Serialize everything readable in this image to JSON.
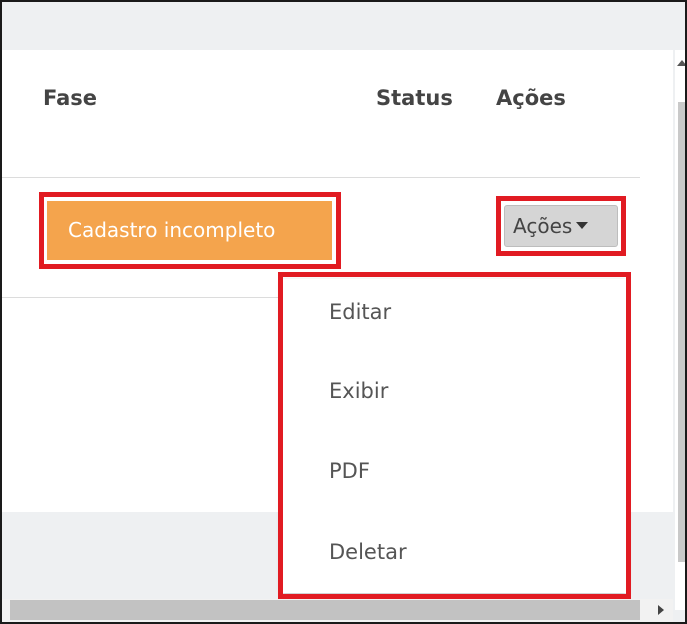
{
  "table": {
    "headers": {
      "fase": "Fase",
      "status": "Status",
      "acoes": "Ações"
    },
    "row": {
      "fase_badge": "Cadastro incompleto",
      "acoes_button": "Ações"
    }
  },
  "dropdown": {
    "items": [
      {
        "label": "Editar"
      },
      {
        "label": "Exibir"
      },
      {
        "label": "PDF"
      },
      {
        "label": "Deletar"
      }
    ]
  },
  "colors": {
    "badge": "#f4a44d",
    "highlight": "#e11b22",
    "button": "#d5d5d5"
  }
}
